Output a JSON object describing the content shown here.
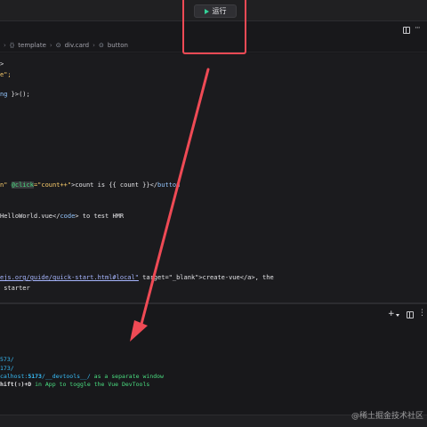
{
  "toolbar": {
    "run_label": "运行"
  },
  "breadcrumb": {
    "template": "template",
    "div_card": "div.card",
    "button": "button"
  },
  "code": {
    "l1": ">",
    "l2": "e\";",
    "l3a": "ng",
    "l3b": " }>();",
    "l4a": "n\"",
    "l4b": "@click",
    "l4c": "=\"count++\"",
    "l4d": ">count is {{ count }}</",
    "l4e": "button",
    "l5": "HelloWorld.vue</",
    "l5b": "code",
    "l5c": "> to test HMR",
    "l6a": "ejs.org/guide/quick-start.html#local\"",
    "l6b": " target=\"_blank\">create-vue</a>, the",
    "l7": " starter"
  },
  "terminal": {
    "line1": "573/",
    "line2": "173/",
    "line3a": "calhost:",
    "line3b": "5173",
    "line3c": "/__devtools__/",
    "line3d": " as a separate window",
    "line4a": "hift(⇧)+D",
    "line4b": " in App to toggle the Vue DevTools"
  },
  "watermark": "@稀土掘金技术社区",
  "colors": {
    "highlight": "#ef4a55",
    "run_icon": "#34d399"
  }
}
